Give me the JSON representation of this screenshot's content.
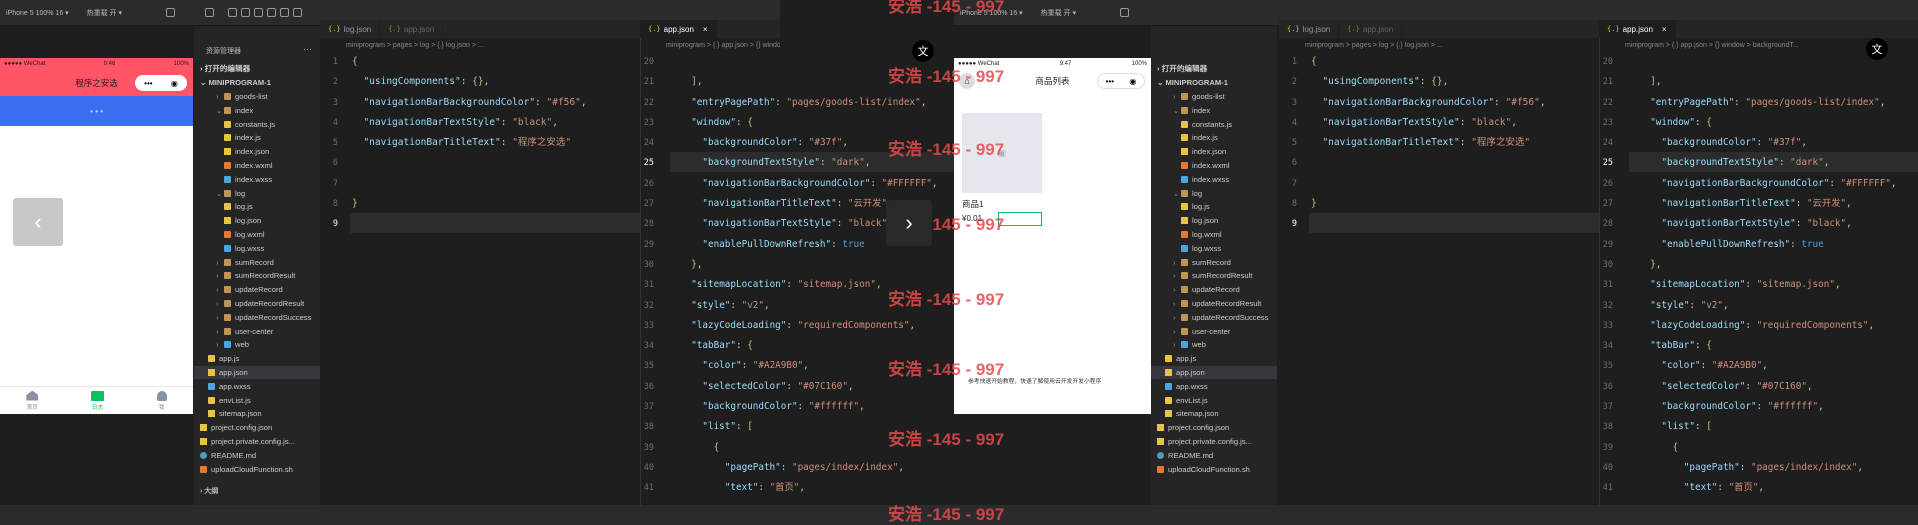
{
  "left": {
    "device_label": "iPhone 5 100% 16 ▾",
    "hot_reload": "热重载 开 ▾",
    "phone": {
      "carrier": "●●●●● WeChat",
      "time": "9:46",
      "battery": "100%",
      "nav_title": "程序之安选",
      "dots": "• • •",
      "tabs": [
        "首页",
        "日志",
        "我"
      ]
    },
    "explorer_title": "资源管理器",
    "open_editors": "打开的编辑器",
    "project": "MINIPROGRAM-1",
    "tree": [
      {
        "name": "goods-list",
        "type": "folder",
        "indent": 1
      },
      {
        "name": "index",
        "type": "folder",
        "indent": 1
      },
      {
        "name": "constants.js",
        "type": "js",
        "indent": 2
      },
      {
        "name": "index.js",
        "type": "js",
        "indent": 2
      },
      {
        "name": "index.json",
        "type": "json",
        "indent": 2
      },
      {
        "name": "index.wxml",
        "type": "wxml",
        "indent": 2
      },
      {
        "name": "index.wxss",
        "type": "wxss",
        "indent": 2
      },
      {
        "name": "log",
        "type": "folder",
        "indent": 1
      },
      {
        "name": "log.js",
        "type": "js",
        "indent": 2
      },
      {
        "name": "log.json",
        "type": "json",
        "indent": 2
      },
      {
        "name": "log.wxml",
        "type": "wxml",
        "indent": 2
      },
      {
        "name": "log.wxss",
        "type": "wxss",
        "indent": 2
      },
      {
        "name": "sumRecord",
        "type": "folder",
        "indent": 1
      },
      {
        "name": "sumRecordResult",
        "type": "folder",
        "indent": 1
      },
      {
        "name": "updateRecord",
        "type": "folder",
        "indent": 1
      },
      {
        "name": "updateRecordResult",
        "type": "folder",
        "indent": 1
      },
      {
        "name": "updateRecordSuccess",
        "type": "folder",
        "indent": 1
      },
      {
        "name": "user-center",
        "type": "folder",
        "indent": 1
      },
      {
        "name": "web",
        "type": "web",
        "indent": 1
      },
      {
        "name": "app.js",
        "type": "js",
        "indent": 0
      },
      {
        "name": "app.json",
        "type": "json",
        "indent": 0,
        "selected": true
      },
      {
        "name": "app.wxss",
        "type": "wxss",
        "indent": 0
      },
      {
        "name": "envList.js",
        "type": "js",
        "indent": 0
      },
      {
        "name": "sitemap.json",
        "type": "json",
        "indent": 0
      },
      {
        "name": "project.config.json",
        "type": "json",
        "indent": -1
      },
      {
        "name": "project.private.config.js...",
        "type": "json",
        "indent": -1
      },
      {
        "name": "README.md",
        "type": "md",
        "indent": -1
      },
      {
        "name": "uploadCloudFunction.sh",
        "type": "sh",
        "indent": -1
      }
    ],
    "outline": "大纲",
    "log_tab": "log.json",
    "app_tab": "app.json",
    "log_crumb": "miniprogram > pages > log > {.} log.json > ...",
    "log_lines": [
      "1",
      "2",
      "3",
      "4",
      "5",
      "6",
      "7",
      "8",
      "9"
    ],
    "log_code": [
      "{",
      "  \"usingComponents\": {},",
      "  \"navigationBarBackgroundColor\": \"#f56\",",
      "  \"navigationBarTextStyle\": \"black\",",
      "  \"navigationBarTitleText\": \"程序之安选\"",
      "",
      "",
      "}",
      ""
    ],
    "app_active_tab": "app.json",
    "app_crumb": "miniprogram > {.} app.json > {} window > backgroundT...",
    "app_lines": [
      "20",
      "21",
      "22",
      "23",
      "24",
      "25",
      "26",
      "27",
      "28",
      "29",
      "30",
      "31",
      "32",
      "33",
      "34",
      "35",
      "36",
      "37",
      "38",
      "39",
      "40",
      "41"
    ],
    "app_code": [
      "",
      "  ],",
      "  \"entryPagePath\": \"pages/goods-list/index\",",
      "  \"window\": {",
      "    \"backgroundColor\": \"#37f\",",
      "    \"backgroundTextStyle\": \"dark\",",
      "    \"navigationBarBackgroundColor\": \"#FFFFFF\",",
      "    \"navigationBarTitleText\": \"云开发\",",
      "    \"navigationBarTextStyle\": \"black\",",
      "    \"enablePullDownRefresh\": true",
      "  },",
      "  \"sitemapLocation\": \"sitemap.json\",",
      "  \"style\": \"v2\",",
      "  \"lazyCodeLoading\": \"requiredComponents\",",
      "  \"tabBar\": {",
      "    \"color\": \"#A2A9B0\",",
      "    \"selectedColor\": \"#07C160\",",
      "    \"backgroundColor\": \"#ffffff\",",
      "    \"list\": [",
      "      {",
      "        \"pagePath\": \"pages/index/index\",",
      "        \"text\": \"首页\","
    ]
  },
  "right": {
    "device_label": "iPhone 5 100% 16 ▾",
    "hot_reload": "热重载 开 ▾",
    "phone": {
      "carrier": "●●●●● WeChat",
      "time": "9:47",
      "battery": "100%",
      "nav_title": "商品列表",
      "item_name": "商品1",
      "item_price": "¥0.01",
      "footer": "参考快速开始教程，快速了解使用云开发开发小程序"
    }
  },
  "watermark": "安浩 -145 - 997"
}
